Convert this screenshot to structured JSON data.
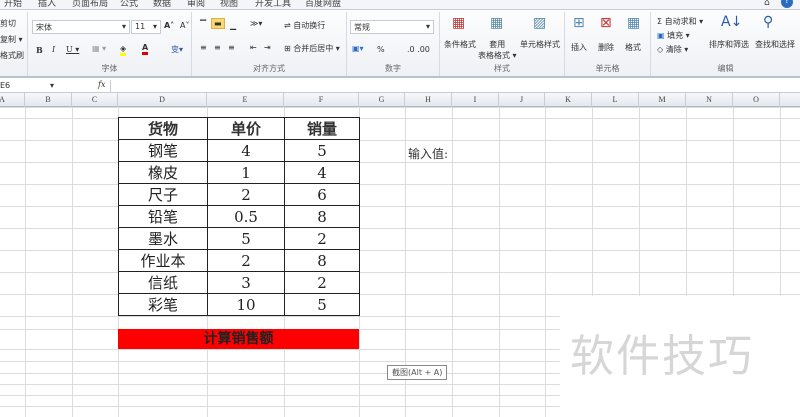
{
  "tabs": [
    "开始",
    "插入",
    "页面布局",
    "公式",
    "数据",
    "审阅",
    "视图",
    "开发工具",
    "百度网盘"
  ],
  "clipboard": {
    "cut": "剪切",
    "copy": "复制 ▾",
    "painter": "格式刷"
  },
  "font": {
    "name": "宋体",
    "size": "11",
    "grow": "A˄",
    "shrink": "A˅",
    "bold": "B",
    "italic": "I",
    "underline": "U ▾",
    "group": "字体"
  },
  "alignment": {
    "wrap": "自动换行",
    "merge": "合并后居中 ▾",
    "group": "对齐方式"
  },
  "number": {
    "format": "常规",
    "percent": "%",
    "group": "数字"
  },
  "styles": {
    "conditional": "条件格式",
    "table": "套用\n表格格式 ▾",
    "cell": "单元格样式",
    "group": "样式"
  },
  "cells": {
    "insert": "插入",
    "delete": "删除",
    "format": "格式",
    "group": "单元格"
  },
  "editing": {
    "autosum": "Σ 自动求和 ▾",
    "fill": "填充 ▾",
    "clear": "清除 ▾",
    "sort": "排序和筛选",
    "find": "查找和选择",
    "group": "编辑"
  },
  "formula_bar": {
    "name_box": "E6",
    "fx": "fx",
    "value": ""
  },
  "columns": [
    "A",
    "B",
    "C",
    "D",
    "E",
    "F",
    "G",
    "H",
    "I",
    "J",
    "K",
    "L",
    "M",
    "N",
    "O"
  ],
  "table": {
    "headers": [
      "货物",
      "单价",
      "销量"
    ],
    "rows": [
      [
        "钢笔",
        "4",
        "5"
      ],
      [
        "橡皮",
        "1",
        "4"
      ],
      [
        "尺子",
        "2",
        "6"
      ],
      [
        "铅笔",
        "0.5",
        "8"
      ],
      [
        "墨水",
        "5",
        "2"
      ],
      [
        "作业本",
        "2",
        "8"
      ],
      [
        "信纸",
        "3",
        "2"
      ],
      [
        "彩笔",
        "10",
        "5"
      ]
    ]
  },
  "calc_button": "计算销售额",
  "input_label": "输入值:",
  "tooltip": "截图(Alt + A)",
  "watermark": "软件技巧",
  "colors": {
    "red_bar": "#ff0000"
  }
}
